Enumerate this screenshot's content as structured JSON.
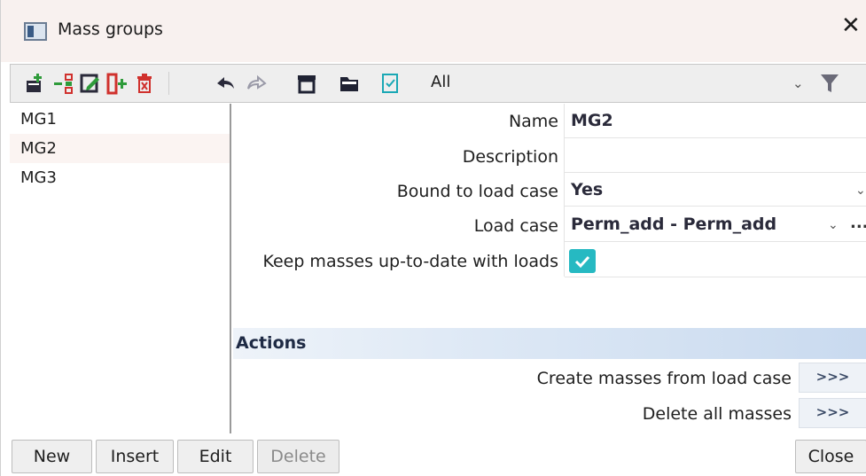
{
  "window": {
    "title": "Mass groups",
    "close_glyph": "✕"
  },
  "toolbar": {
    "icons": [
      "new-item-icon",
      "insert-item-icon",
      "edit-item-icon",
      "insert-column-icon",
      "delete-item-icon",
      "undo-icon",
      "redo-icon",
      "archive-icon",
      "open-folder-icon",
      "checklist-icon"
    ],
    "filter_value": "All",
    "filter_chevron": "⌄",
    "accent_green": "#2e9b3a",
    "accent_red": "#d0312d",
    "accent_teal": "#1aa8b5"
  },
  "list": {
    "items": [
      "MG1",
      "MG2",
      "MG3"
    ],
    "selected_index": 1
  },
  "properties": {
    "name_label": "Name",
    "name_value": "MG2",
    "description_label": "Description",
    "description_value": "",
    "bound_label": "Bound to load case",
    "bound_value": "Yes",
    "loadcase_label": "Load case",
    "loadcase_value": "Perm_add - Perm_add",
    "keep_label": "Keep masses up-to-date with loads",
    "keep_checked": true,
    "ellipsis": "..."
  },
  "actions": {
    "title": "Actions",
    "items": [
      {
        "label": "Create masses from load case",
        "button": ">>>"
      },
      {
        "label": "Delete all masses",
        "button": ">>>"
      }
    ]
  },
  "buttons": {
    "new": "New",
    "insert": "Insert",
    "edit": "Edit",
    "delete": "Delete",
    "close": "Close"
  },
  "colors": {
    "checkbox": "#26b9c2",
    "selection": "#fbf4f2",
    "actions_band": "#c9daef"
  }
}
